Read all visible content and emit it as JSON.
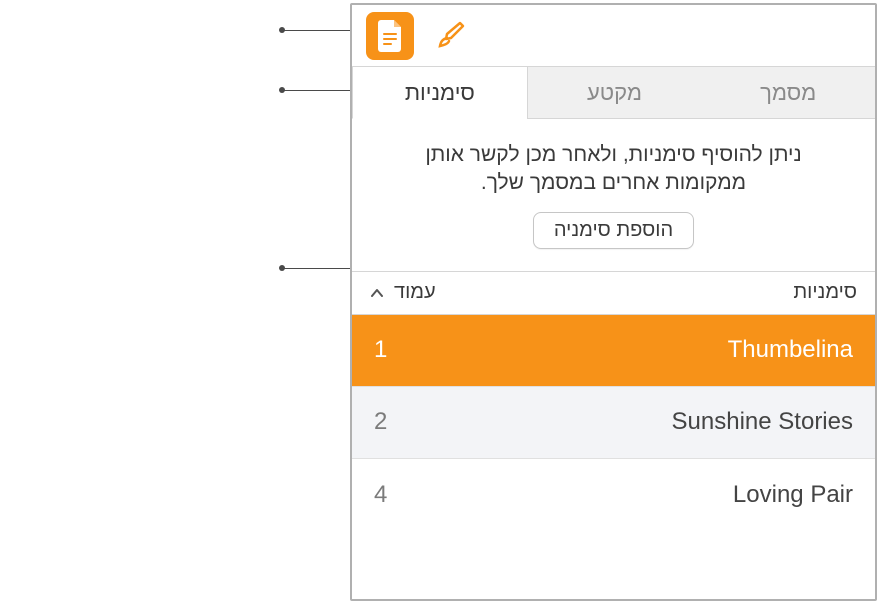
{
  "toolbar": {
    "document_icon": "document-icon",
    "format_icon": "format-brush-icon"
  },
  "tabs": [
    {
      "id": "bookmarks",
      "label": "סימניות",
      "active": true
    },
    {
      "id": "section",
      "label": "מקטע",
      "active": false
    },
    {
      "id": "document",
      "label": "מסמך",
      "active": false
    }
  ],
  "description": "ניתן להוסיף סימניות, ולאחר מכן לקשר אותן ממקומות אחרים במסמך שלך.",
  "add_button_label": "הוספת סימניה",
  "table": {
    "headers": {
      "page": "עמוד",
      "bookmarks": "סימניות"
    },
    "rows": [
      {
        "page": "1",
        "name": "Thumbelina",
        "selected": true,
        "alt": false
      },
      {
        "page": "2",
        "name": "Sunshine Stories",
        "selected": false,
        "alt": true
      },
      {
        "page": "4",
        "name": "Loving Pair",
        "selected": false,
        "alt": false
      }
    ]
  }
}
